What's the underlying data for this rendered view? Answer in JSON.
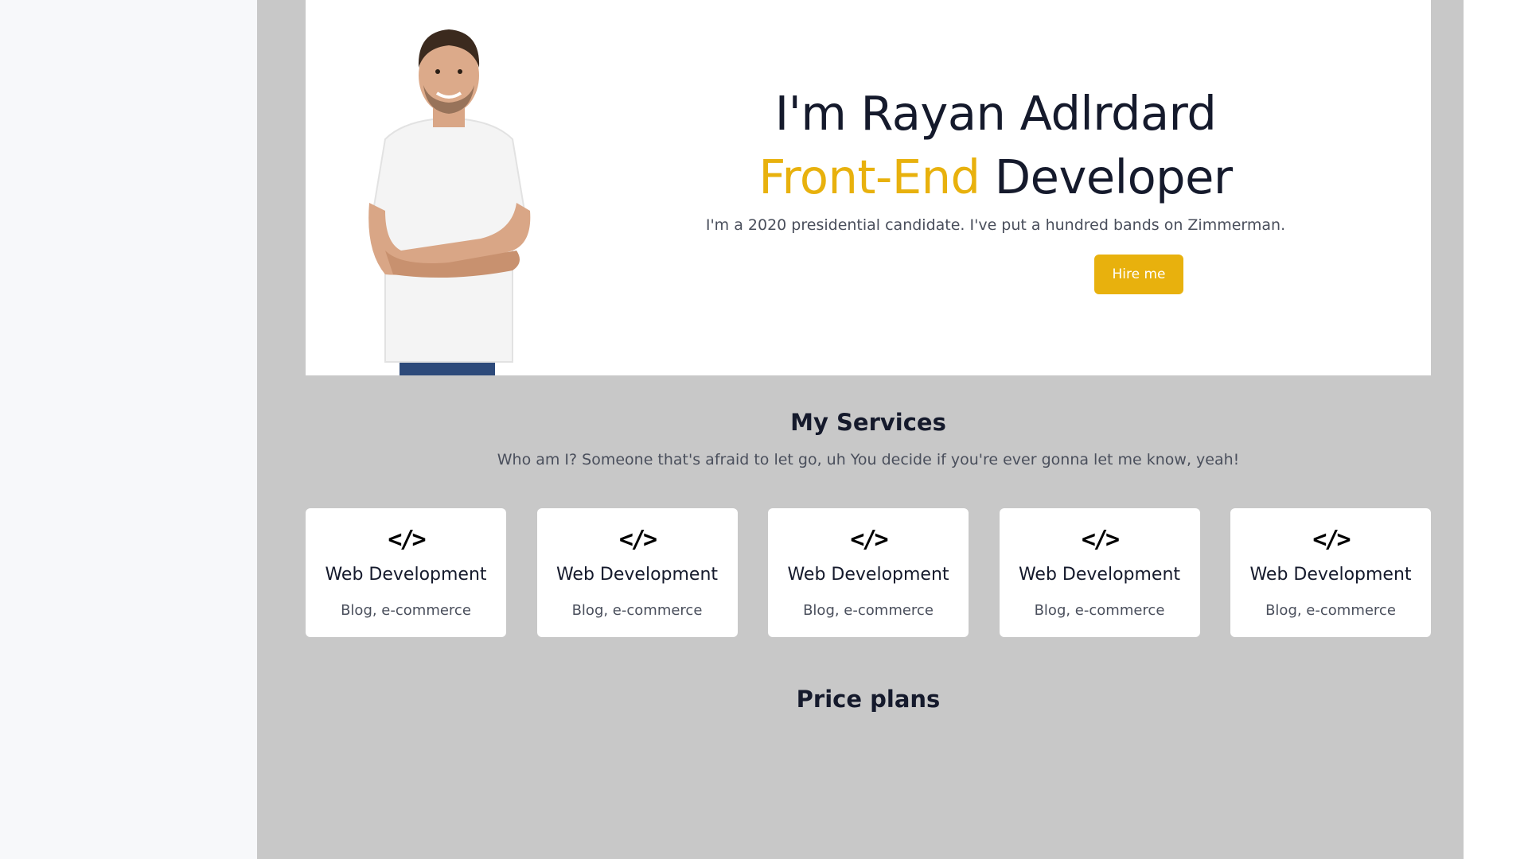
{
  "hero": {
    "name": "I'm Rayan Adlrdard",
    "role_accent": "Front-End",
    "role_rest": "Developer",
    "description": "I'm a 2020 presidential candidate. I've put a hundred bands on Zimmerman.",
    "hire_label": "Hire me"
  },
  "services": {
    "title": "My Services",
    "subtitle": "Who am I? Someone that's afraid to let go, uh You decide if you're ever gonna let me know, yeah!",
    "items": [
      {
        "icon": "code-icon",
        "title": "Web Development",
        "subtitle": "Blog, e-commerce"
      },
      {
        "icon": "code-icon",
        "title": "Web Development",
        "subtitle": "Blog, e-commerce"
      },
      {
        "icon": "code-icon",
        "title": "Web Development",
        "subtitle": "Blog, e-commerce"
      },
      {
        "icon": "code-icon",
        "title": "Web Development",
        "subtitle": "Blog, e-commerce"
      },
      {
        "icon": "code-icon",
        "title": "Web Development",
        "subtitle": "Blog, e-commerce"
      }
    ]
  },
  "pricing": {
    "title": "Price plans"
  },
  "colors": {
    "accent": "#e8b10d",
    "text_dark": "#151a2c",
    "page_bg": "#c8c8c8"
  }
}
